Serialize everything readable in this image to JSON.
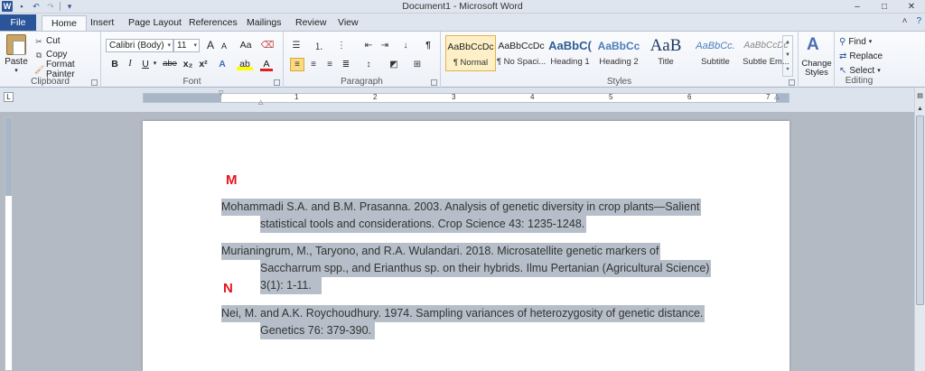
{
  "window": {
    "title": "Document1 - Microsoft Word",
    "logo": "W",
    "controls": [
      "minimize-icon",
      "maximize-icon",
      "close-icon"
    ]
  },
  "tabs": {
    "file": "File",
    "items": [
      "Home",
      "Insert",
      "Page Layout",
      "References",
      "Mailings",
      "Review",
      "View"
    ]
  },
  "clipboard": {
    "paste": "Paste",
    "cut": "Cut",
    "copy": "Copy",
    "format_painter": "Format Painter",
    "label": "Clipboard"
  },
  "font": {
    "name": "Calibri (Body)",
    "size": "11",
    "grow": "A",
    "shrink": "A",
    "case": "Aa",
    "bold": "B",
    "italic": "I",
    "underline": "U",
    "strike": "abe",
    "subscript": "x₂",
    "superscript": "x²",
    "effects": "A",
    "highlight": "ab",
    "color": "A",
    "label": "Font"
  },
  "paragraph": {
    "label": "Paragraph"
  },
  "styles": {
    "label": "Styles",
    "items": [
      {
        "preview": "AaBbCcDc",
        "name": "¶ Normal"
      },
      {
        "preview": "AaBbCcDc",
        "name": "¶ No Spaci..."
      },
      {
        "preview": "AaBbC(",
        "name": "Heading 1"
      },
      {
        "preview": "AaBbCc",
        "name": "Heading 2"
      },
      {
        "preview": "AaB",
        "name": "Title"
      },
      {
        "preview": "AaBbCc.",
        "name": "Subtitle"
      },
      {
        "preview": "AaBbCcDc",
        "name": "Subtle Em..."
      }
    ],
    "change_styles": "Change Styles"
  },
  "editing": {
    "find": "Find",
    "replace": "Replace",
    "select": "Select",
    "label": "Editing"
  },
  "ruler": {
    "numbers": [
      "1",
      "2",
      "3",
      "4",
      "5",
      "6",
      "7"
    ]
  },
  "colors": {
    "accent": "#2a5699",
    "highlight": "#b6bfc9",
    "section_letter": "#e8141c"
  },
  "document": {
    "letter_m": "M",
    "letter_n": "N",
    "refs": [
      {
        "line1": "Mohammadi S.A. and B.M. Prasanna. 2003. Analysis of genetic diversity in crop plants—Salient",
        "line2": "statistical tools and considerations. Crop Science 43: 1235-1248."
      },
      {
        "line1": "Murianingrum, M., Taryono, and R.A. Wulandari. 2018. Microsatellite genetic markers of",
        "line2": "Saccharrum spp., and Erianthus sp. on their hybrids. Ilmu Pertanian (Agricultural Science)",
        "line3": "3(1): 1-11."
      },
      {
        "line1": "Nei, M. and A.K. Roychoudhury. 1974. Sampling variances of heterozygosity of genetic distance.",
        "line2": "Genetics 76: 379-390."
      }
    ]
  }
}
